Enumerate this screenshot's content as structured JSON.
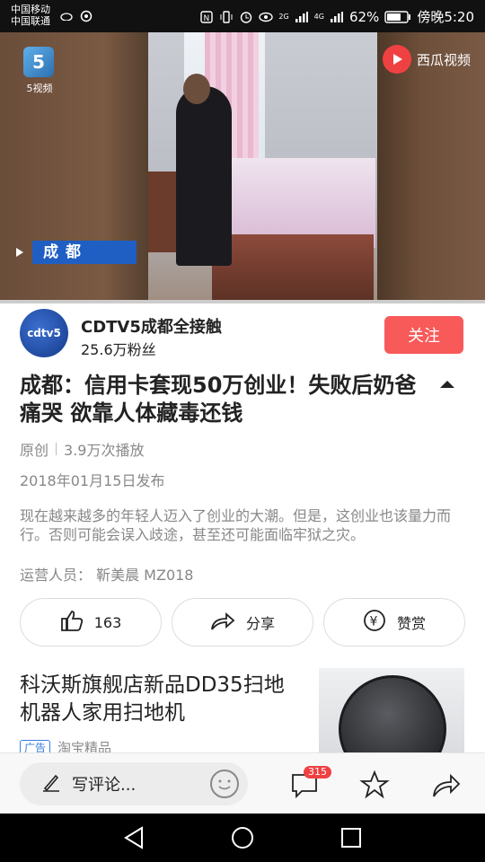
{
  "status": {
    "carrier1": "中国移动",
    "carrier2": "中国联通",
    "net1": "2G",
    "net2": "4G",
    "battery": "62%",
    "time": "傍晚5:20"
  },
  "video": {
    "logo_text": "5视频",
    "logo_badge": "5",
    "brand": "西瓜视频",
    "city_tag": "成都"
  },
  "author": {
    "name": "CDTV5成都全接触",
    "fans": "25.6万粉丝",
    "follow_label": "关注",
    "avatar_text": "cdtv5"
  },
  "article": {
    "title": "成都：信用卡套现50万创业！失败后奶爸痛哭 欲靠人体藏毒还钱",
    "original": "原创",
    "plays": "3.9万次播放",
    "published": "2018年01月15日发布",
    "description": "现在越来越多的年轻人迈入了创业的大潮。但是，这创业也该量力而行。否则可能会误入歧途，甚至还可能面临牢狱之灾。",
    "operator": "运营人员： 靳美晨 MZ018"
  },
  "actions": {
    "like_count": "163",
    "share_label": "分享",
    "reward_label": "赞赏"
  },
  "ad": {
    "title": "科沃斯旗舰店新品DD35扫地机器人家用扫地机",
    "label": "广告",
    "source": "淘宝精品"
  },
  "bottom": {
    "comment_placeholder": "写评论...",
    "comment_count": "315"
  },
  "colors": {
    "accent": "#f85959",
    "city_tag_bg": "#1f5fc4",
    "ad_label": "#3a7ee0"
  }
}
